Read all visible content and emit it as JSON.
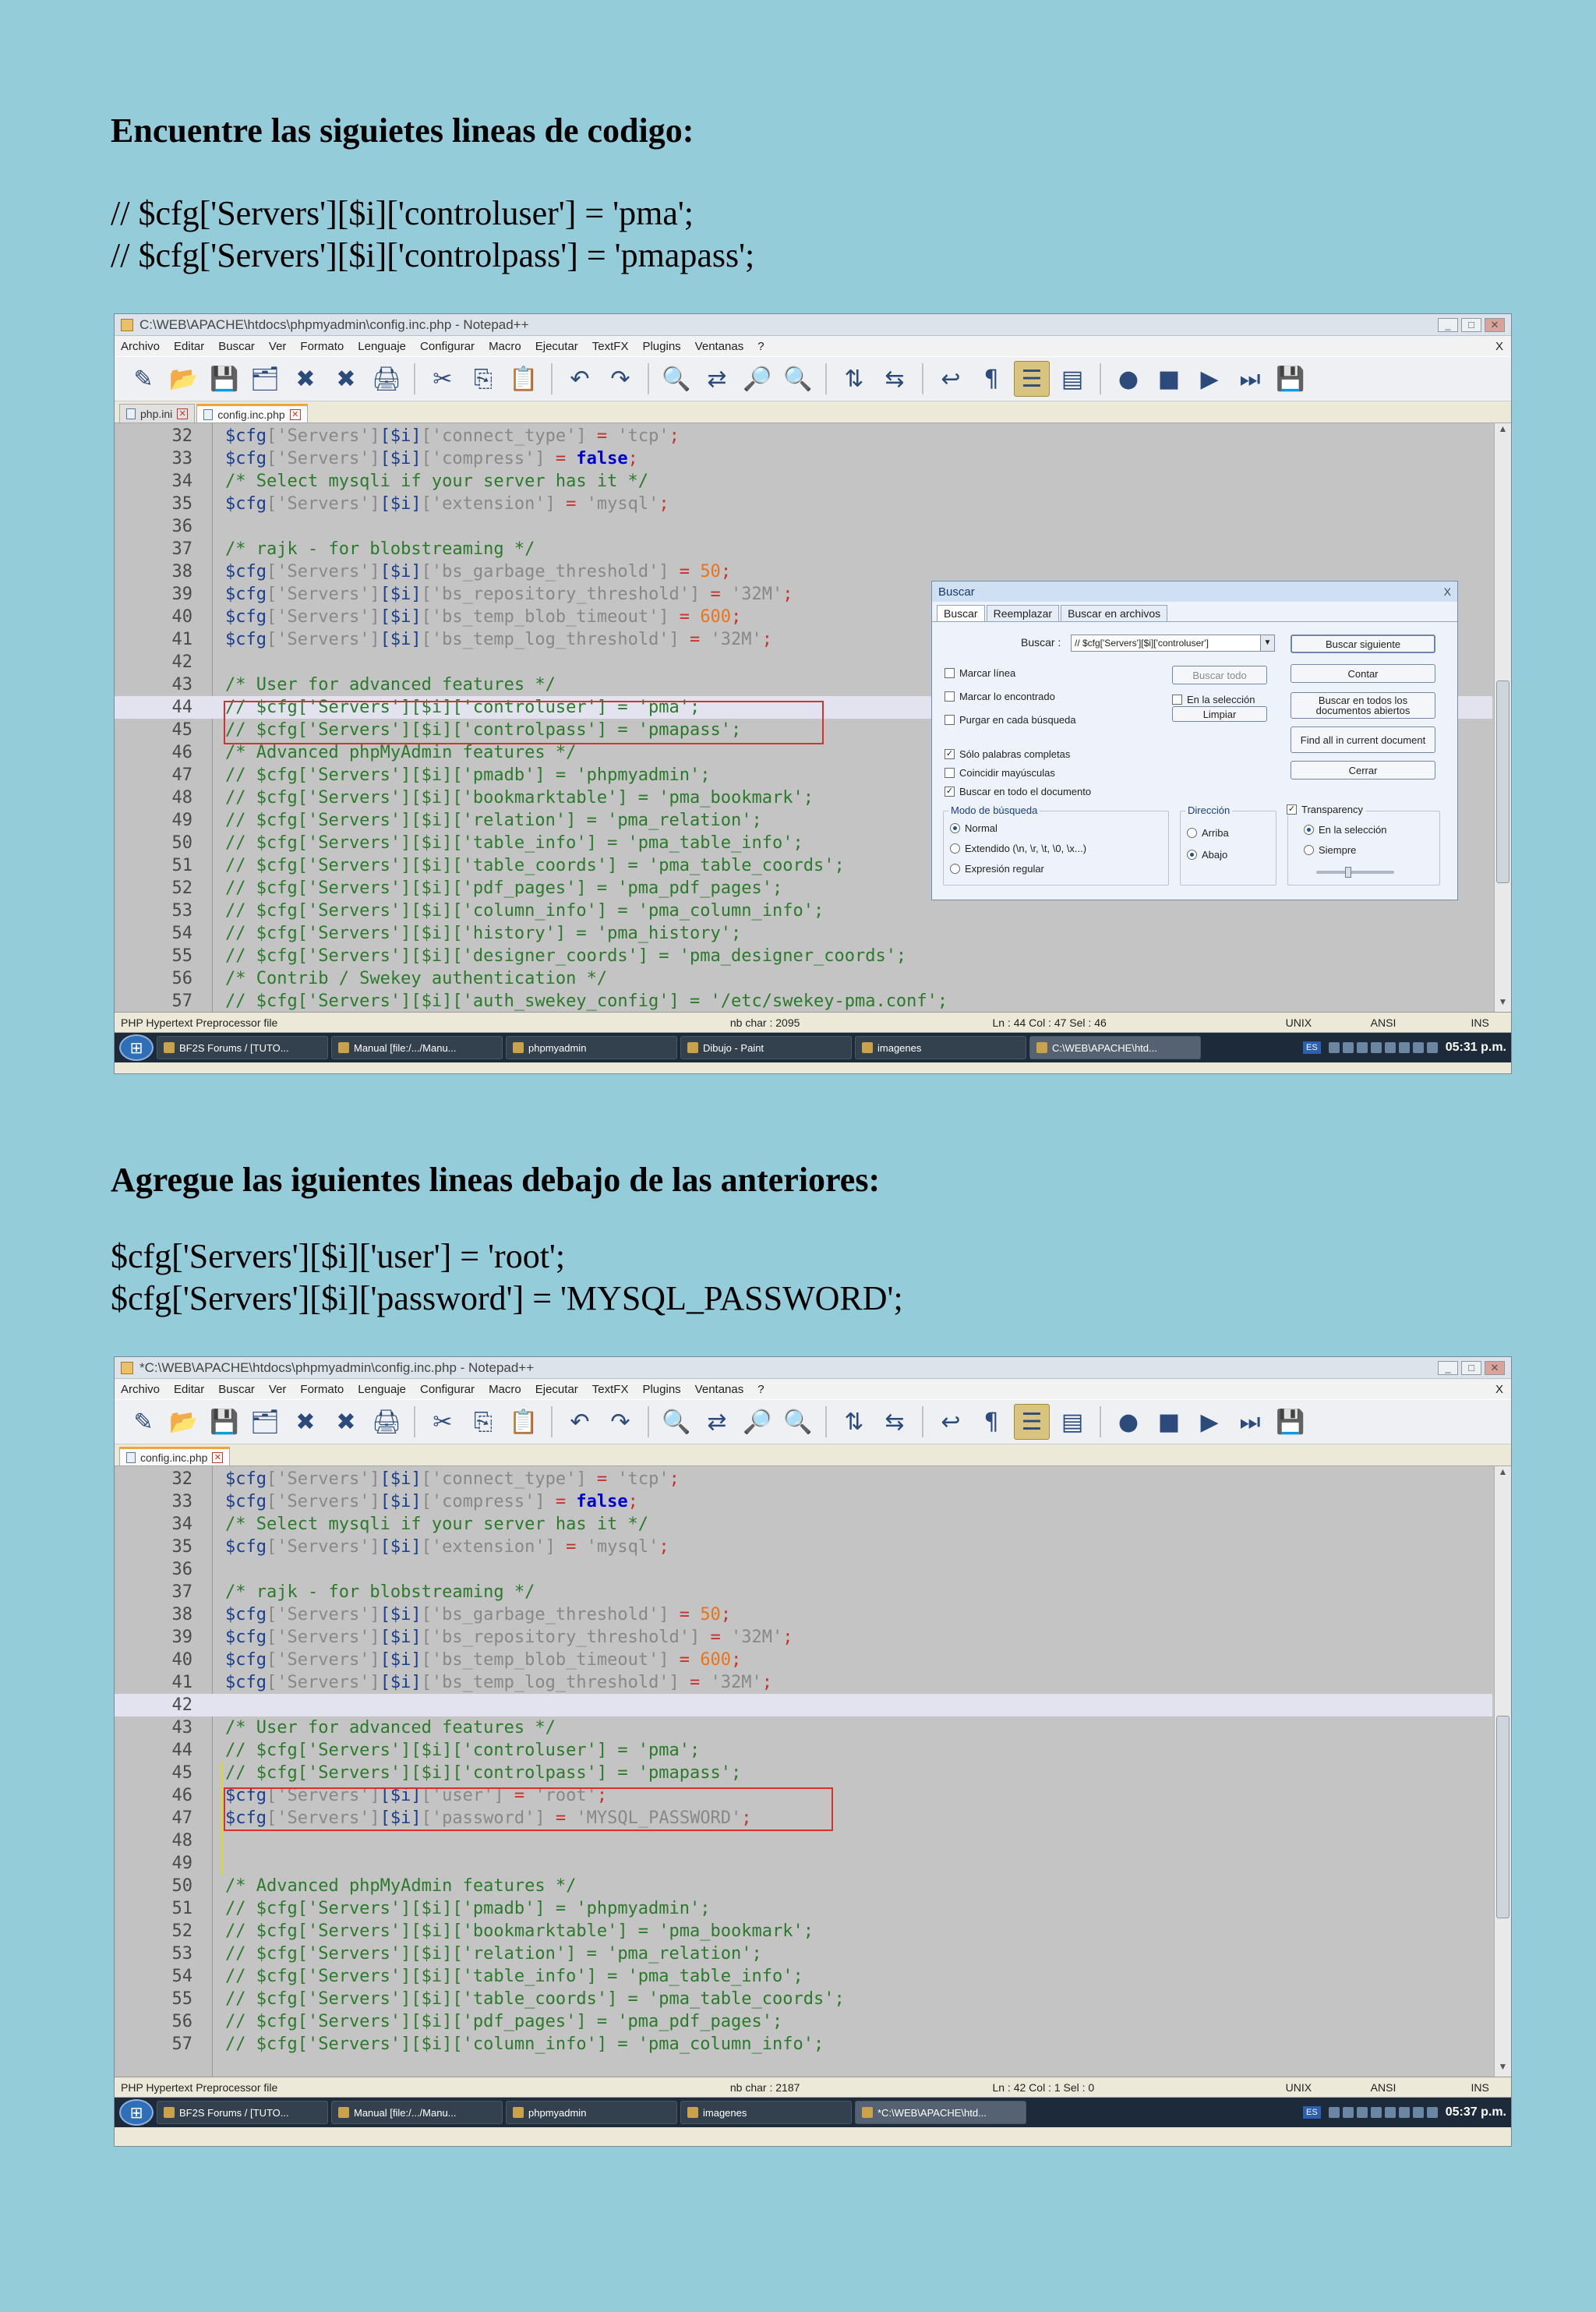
{
  "section1": {
    "heading": "Encuentre las siguietes lineas de codigo:",
    "lines": [
      "// $cfg['Servers'][$i]['controluser'] = 'pma';",
      "// $cfg['Servers'][$i]['controlpass'] = 'pmapass';"
    ]
  },
  "section2": {
    "heading": "Agregue las iguientes lineas debajo de las anteriores:",
    "lines": [
      "$cfg['Servers'][$i]['user'] = 'root';",
      "$cfg['Servers'][$i]['password'] = 'MYSQL_PASSWORD';"
    ]
  },
  "menu": [
    "Archivo",
    "Editar",
    "Buscar",
    "Ver",
    "Formato",
    "Lenguaje",
    "Configurar",
    "Macro",
    "Ejecutar",
    "TextFX",
    "Plugins",
    "Ventanas",
    "?"
  ],
  "menu_close": "X",
  "toolbar_icons": [
    {
      "name": "new-file-icon",
      "glyph": "✎"
    },
    {
      "name": "open-file-icon",
      "glyph": "📂"
    },
    {
      "name": "save-icon",
      "glyph": "💾"
    },
    {
      "name": "save-all-icon",
      "glyph": "🗂"
    },
    {
      "name": "close-icon",
      "glyph": "✖"
    },
    {
      "name": "close-all-icon",
      "glyph": "✖"
    },
    {
      "name": "print-icon",
      "glyph": "🖨"
    },
    {
      "name": "cut-icon",
      "glyph": "✂"
    },
    {
      "name": "copy-icon",
      "glyph": "⎘"
    },
    {
      "name": "paste-icon",
      "glyph": "📋"
    },
    {
      "name": "undo-icon",
      "glyph": "↶"
    },
    {
      "name": "redo-icon",
      "glyph": "↷"
    },
    {
      "name": "find-icon",
      "glyph": "🔍"
    },
    {
      "name": "replace-icon",
      "glyph": "⇄"
    },
    {
      "name": "zoom-in-icon",
      "glyph": "🔎"
    },
    {
      "name": "zoom-out-icon",
      "glyph": "🔍"
    },
    {
      "name": "sync-vertical-icon",
      "glyph": "⇅"
    },
    {
      "name": "sync-horizontal-icon",
      "glyph": "⇆"
    },
    {
      "name": "word-wrap-icon",
      "glyph": "↩"
    },
    {
      "name": "show-all-chars-icon",
      "glyph": "¶"
    },
    {
      "name": "indent-guide-icon",
      "glyph": "☰",
      "active": true
    },
    {
      "name": "user-lang-icon",
      "glyph": "▤"
    },
    {
      "name": "macro-record-icon",
      "glyph": "●"
    },
    {
      "name": "macro-stop-icon",
      "glyph": "■"
    },
    {
      "name": "macro-play-icon",
      "glyph": "▶"
    },
    {
      "name": "macro-play-multiple-icon",
      "glyph": "⏭"
    },
    {
      "name": "macro-save-icon",
      "glyph": "💾"
    }
  ],
  "colors": {
    "page_bg": "#94ccda",
    "editor_bg": "#c4c4c4",
    "var": "#1a3f8c",
    "string": "#888888",
    "operator": "#c9302c",
    "number": "#e8741e",
    "keyword": "#0000cc",
    "comment": "#2b7a2b",
    "red_box": "#d9302e"
  },
  "screenshot1": {
    "title": "C:\\WEB\\APACHE\\htdocs\\phpmyadmin\\config.inc.php - Notepad++",
    "tabs": [
      {
        "label": "php.ini",
        "active": false
      },
      {
        "label": "config.inc.php",
        "active": true
      }
    ],
    "code_lines": [
      {
        "n": "32",
        "segs": [
          [
            "var",
            "$cfg"
          ],
          [
            "str",
            "['Servers']"
          ],
          [
            "var",
            "[$i]"
          ],
          [
            "str",
            "['connect_type']"
          ],
          [
            "op",
            " = "
          ],
          [
            "str",
            "'tcp'"
          ],
          [
            "op",
            ";"
          ]
        ]
      },
      {
        "n": "33",
        "segs": [
          [
            "var",
            "$cfg"
          ],
          [
            "str",
            "['Servers']"
          ],
          [
            "var",
            "[$i]"
          ],
          [
            "str",
            "['compress']"
          ],
          [
            "op",
            " = "
          ],
          [
            "kw",
            "false"
          ],
          [
            "op",
            ";"
          ]
        ]
      },
      {
        "n": "34",
        "segs": [
          [
            "cm",
            "/* Select mysqli if your server has it */"
          ]
        ]
      },
      {
        "n": "35",
        "segs": [
          [
            "var",
            "$cfg"
          ],
          [
            "str",
            "['Servers']"
          ],
          [
            "var",
            "[$i]"
          ],
          [
            "str",
            "['extension']"
          ],
          [
            "op",
            " = "
          ],
          [
            "str",
            "'mysql'"
          ],
          [
            "op",
            ";"
          ]
        ]
      },
      {
        "n": "36",
        "segs": []
      },
      {
        "n": "37",
        "segs": [
          [
            "cm",
            "/* rajk - for blobstreaming */"
          ]
        ]
      },
      {
        "n": "38",
        "segs": [
          [
            "var",
            "$cfg"
          ],
          [
            "str",
            "['Servers']"
          ],
          [
            "var",
            "[$i]"
          ],
          [
            "str",
            "['bs_garbage_threshold']"
          ],
          [
            "op",
            " = "
          ],
          [
            "num",
            "50"
          ],
          [
            "op",
            ";"
          ]
        ]
      },
      {
        "n": "39",
        "segs": [
          [
            "var",
            "$cfg"
          ],
          [
            "str",
            "['Servers']"
          ],
          [
            "var",
            "[$i]"
          ],
          [
            "str",
            "['bs_repository_threshold']"
          ],
          [
            "op",
            " = "
          ],
          [
            "str",
            "'32M'"
          ],
          [
            "op",
            ";"
          ]
        ]
      },
      {
        "n": "40",
        "segs": [
          [
            "var",
            "$cfg"
          ],
          [
            "str",
            "['Servers']"
          ],
          [
            "var",
            "[$i]"
          ],
          [
            "str",
            "['bs_temp_blob_timeout']"
          ],
          [
            "op",
            " = "
          ],
          [
            "num",
            "600"
          ],
          [
            "op",
            ";"
          ]
        ]
      },
      {
        "n": "41",
        "segs": [
          [
            "var",
            "$cfg"
          ],
          [
            "str",
            "['Servers']"
          ],
          [
            "var",
            "[$i]"
          ],
          [
            "str",
            "['bs_temp_log_threshold']"
          ],
          [
            "op",
            " = "
          ],
          [
            "str",
            "'32M'"
          ],
          [
            "op",
            ";"
          ]
        ]
      },
      {
        "n": "42",
        "segs": []
      },
      {
        "n": "43",
        "segs": [
          [
            "cm",
            "/* User for advanced features */"
          ]
        ]
      },
      {
        "n": "44",
        "segs": [
          [
            "cm",
            "// $cfg['Servers'][$i]['controluser'] = 'pma';"
          ]
        ],
        "hl": true
      },
      {
        "n": "45",
        "segs": [
          [
            "cm",
            "// $cfg['Servers'][$i]['controlpass'] = 'pmapass';"
          ]
        ]
      },
      {
        "n": "46",
        "segs": [
          [
            "cm",
            "/* Advanced phpMyAdmin features */"
          ]
        ]
      },
      {
        "n": "47",
        "segs": [
          [
            "cm",
            "// $cfg['Servers'][$i]['pmadb'] = 'phpmyadmin';"
          ]
        ]
      },
      {
        "n": "48",
        "segs": [
          [
            "cm",
            "// $cfg['Servers'][$i]['bookmarktable'] = 'pma_bookmark';"
          ]
        ]
      },
      {
        "n": "49",
        "segs": [
          [
            "cm",
            "// $cfg['Servers'][$i]['relation'] = 'pma_relation';"
          ]
        ]
      },
      {
        "n": "50",
        "segs": [
          [
            "cm",
            "// $cfg['Servers'][$i]['table_info'] = 'pma_table_info';"
          ]
        ]
      },
      {
        "n": "51",
        "segs": [
          [
            "cm",
            "// $cfg['Servers'][$i]['table_coords'] = 'pma_table_coords';"
          ]
        ]
      },
      {
        "n": "52",
        "segs": [
          [
            "cm",
            "// $cfg['Servers'][$i]['pdf_pages'] = 'pma_pdf_pages';"
          ]
        ]
      },
      {
        "n": "53",
        "segs": [
          [
            "cm",
            "// $cfg['Servers'][$i]['column_info'] = 'pma_column_info';"
          ]
        ]
      },
      {
        "n": "54",
        "segs": [
          [
            "cm",
            "// $cfg['Servers'][$i]['history'] = 'pma_history';"
          ]
        ]
      },
      {
        "n": "55",
        "segs": [
          [
            "cm",
            "// $cfg['Servers'][$i]['designer_coords'] = 'pma_designer_coords';"
          ]
        ]
      },
      {
        "n": "56",
        "segs": [
          [
            "cm",
            "/* Contrib / Swekey authentication */"
          ]
        ]
      },
      {
        "n": "57",
        "segs": [
          [
            "cm",
            "// $cfg['Servers'][$i]['auth_swekey_config'] = '/etc/swekey-pma.conf';"
          ]
        ]
      }
    ],
    "status": {
      "filetype": "PHP Hypertext Preprocessor file",
      "nbchar": "nb char : 2095",
      "pos": "Ln : 44    Col : 47    Sel : 46",
      "eol": "UNIX",
      "enc": "ANSI",
      "mode": "INS"
    },
    "taskbar": [
      {
        "label": "BF2S Forums / [TUTO...",
        "active": false
      },
      {
        "label": "Manual [file:/.../Manu...",
        "active": false
      },
      {
        "label": "phpmyadmin",
        "active": false
      },
      {
        "label": "Dibujo - Paint",
        "active": false
      },
      {
        "label": "imagenes",
        "active": false
      },
      {
        "label": "C:\\WEB\\APACHE\\htd...",
        "active": true
      }
    ],
    "lang": "ES",
    "clock": "05:31 p.m."
  },
  "dialog": {
    "title": "Buscar",
    "close": "X",
    "tabs": [
      "Buscar",
      "Reemplazar",
      "Buscar en archivos"
    ],
    "find_label": "Buscar :",
    "find_value": "// $cfg['Servers'][$i]['controluser']",
    "buttons": {
      "find_next": "Buscar siguiente",
      "count": "Contar",
      "find_all_open": "Buscar en todos los documentos abiertos",
      "find_all_current": "Find all in current document",
      "close": "Cerrar",
      "find_all": "Buscar todo",
      "clear": "Limpiar"
    },
    "checks": {
      "mark_line": "Marcar línea",
      "mark_found": "Marcar lo encontrado",
      "purge": "Purgar en cada búsqueda",
      "in_selection": "En la selección",
      "whole_words": "Sólo palabras completas",
      "match_case": "Coincidir mayúsculas",
      "wrap": "Buscar en todo el documento"
    },
    "mode_label": "Modo de búsqueda",
    "modes": [
      "Normal",
      "Extendido (\\n, \\r, \\t, \\0, \\x...)",
      "Expresión regular"
    ],
    "direction_label": "Dirección",
    "directions": [
      "Arriba",
      "Abajo"
    ],
    "transparency_label": "Transparency",
    "transparency_opts": [
      "En la selección",
      "Siempre"
    ],
    "transparency_level": 0.4
  },
  "screenshot2": {
    "title": "*C:\\WEB\\APACHE\\htdocs\\phpmyadmin\\config.inc.php - Notepad++",
    "tabs": [
      {
        "label": "config.inc.php",
        "active": true
      }
    ],
    "code_lines": [
      {
        "n": "32",
        "segs": [
          [
            "var",
            "$cfg"
          ],
          [
            "str",
            "['Servers']"
          ],
          [
            "var",
            "[$i]"
          ],
          [
            "str",
            "['connect_type']"
          ],
          [
            "op",
            " = "
          ],
          [
            "str",
            "'tcp'"
          ],
          [
            "op",
            ";"
          ]
        ]
      },
      {
        "n": "33",
        "segs": [
          [
            "var",
            "$cfg"
          ],
          [
            "str",
            "['Servers']"
          ],
          [
            "var",
            "[$i]"
          ],
          [
            "str",
            "['compress']"
          ],
          [
            "op",
            " = "
          ],
          [
            "kw",
            "false"
          ],
          [
            "op",
            ";"
          ]
        ]
      },
      {
        "n": "34",
        "segs": [
          [
            "cm",
            "/* Select mysqli if your server has it */"
          ]
        ]
      },
      {
        "n": "35",
        "segs": [
          [
            "var",
            "$cfg"
          ],
          [
            "str",
            "['Servers']"
          ],
          [
            "var",
            "[$i]"
          ],
          [
            "str",
            "['extension']"
          ],
          [
            "op",
            " = "
          ],
          [
            "str",
            "'mysql'"
          ],
          [
            "op",
            ";"
          ]
        ]
      },
      {
        "n": "36",
        "segs": []
      },
      {
        "n": "37",
        "segs": [
          [
            "cm",
            "/* rajk - for blobstreaming */"
          ]
        ]
      },
      {
        "n": "38",
        "segs": [
          [
            "var",
            "$cfg"
          ],
          [
            "str",
            "['Servers']"
          ],
          [
            "var",
            "[$i]"
          ],
          [
            "str",
            "['bs_garbage_threshold']"
          ],
          [
            "op",
            " = "
          ],
          [
            "num",
            "50"
          ],
          [
            "op",
            ";"
          ]
        ]
      },
      {
        "n": "39",
        "segs": [
          [
            "var",
            "$cfg"
          ],
          [
            "str",
            "['Servers']"
          ],
          [
            "var",
            "[$i]"
          ],
          [
            "str",
            "['bs_repository_threshold']"
          ],
          [
            "op",
            " = "
          ],
          [
            "str",
            "'32M'"
          ],
          [
            "op",
            ";"
          ]
        ]
      },
      {
        "n": "40",
        "segs": [
          [
            "var",
            "$cfg"
          ],
          [
            "str",
            "['Servers']"
          ],
          [
            "var",
            "[$i]"
          ],
          [
            "str",
            "['bs_temp_blob_timeout']"
          ],
          [
            "op",
            " = "
          ],
          [
            "num",
            "600"
          ],
          [
            "op",
            ";"
          ]
        ]
      },
      {
        "n": "41",
        "segs": [
          [
            "var",
            "$cfg"
          ],
          [
            "str",
            "['Servers']"
          ],
          [
            "var",
            "[$i]"
          ],
          [
            "str",
            "['bs_temp_log_threshold']"
          ],
          [
            "op",
            " = "
          ],
          [
            "str",
            "'32M'"
          ],
          [
            "op",
            ";"
          ]
        ]
      },
      {
        "n": "42",
        "segs": [],
        "hl": true
      },
      {
        "n": "43",
        "segs": [
          [
            "cm",
            "/* User for advanced features */"
          ]
        ]
      },
      {
        "n": "44",
        "segs": [
          [
            "cm",
            "// $cfg['Servers'][$i]['controluser'] = 'pma';"
          ]
        ]
      },
      {
        "n": "45",
        "segs": [
          [
            "cm",
            "// $cfg['Servers'][$i]['controlpass'] = 'pmapass';"
          ]
        ],
        "change": true
      },
      {
        "n": "46",
        "segs": [
          [
            "var",
            "$cfg"
          ],
          [
            "str",
            "['Servers']"
          ],
          [
            "var",
            "[$i]"
          ],
          [
            "str",
            "['user']"
          ],
          [
            "op",
            " = "
          ],
          [
            "str",
            "'root'"
          ],
          [
            "op",
            ";"
          ]
        ],
        "change": true
      },
      {
        "n": "47",
        "segs": [
          [
            "var",
            "$cfg"
          ],
          [
            "str",
            "['Servers']"
          ],
          [
            "var",
            "[$i]"
          ],
          [
            "str",
            "['password']"
          ],
          [
            "op",
            " = "
          ],
          [
            "str",
            "'MYSQL_PASSWORD'"
          ],
          [
            "op",
            ";"
          ]
        ],
        "change": true
      },
      {
        "n": "48",
        "segs": [],
        "change": true
      },
      {
        "n": "49",
        "segs": [],
        "change": true
      },
      {
        "n": "50",
        "segs": [
          [
            "cm",
            "/* Advanced phpMyAdmin features */"
          ]
        ]
      },
      {
        "n": "51",
        "segs": [
          [
            "cm",
            "// $cfg['Servers'][$i]['pmadb'] = 'phpmyadmin';"
          ]
        ]
      },
      {
        "n": "52",
        "segs": [
          [
            "cm",
            "// $cfg['Servers'][$i]['bookmarktable'] = 'pma_bookmark';"
          ]
        ]
      },
      {
        "n": "53",
        "segs": [
          [
            "cm",
            "// $cfg['Servers'][$i]['relation'] = 'pma_relation';"
          ]
        ]
      },
      {
        "n": "54",
        "segs": [
          [
            "cm",
            "// $cfg['Servers'][$i]['table_info'] = 'pma_table_info';"
          ]
        ]
      },
      {
        "n": "55",
        "segs": [
          [
            "cm",
            "// $cfg['Servers'][$i]['table_coords'] = 'pma_table_coords';"
          ]
        ]
      },
      {
        "n": "56",
        "segs": [
          [
            "cm",
            "// $cfg['Servers'][$i]['pdf_pages'] = 'pma_pdf_pages';"
          ]
        ]
      },
      {
        "n": "57",
        "segs": [
          [
            "cm",
            "// $cfg['Servers'][$i]['column_info'] = 'pma_column_info';"
          ]
        ]
      }
    ],
    "status": {
      "filetype": "PHP Hypertext Preprocessor file",
      "nbchar": "nb char : 2187",
      "pos": "Ln : 42    Col : 1    Sel : 0",
      "eol": "UNIX",
      "enc": "ANSI",
      "mode": "INS"
    },
    "taskbar": [
      {
        "label": "BF2S Forums / [TUTO...",
        "active": false
      },
      {
        "label": "Manual [file:/.../Manu...",
        "active": false
      },
      {
        "label": "phpmyadmin",
        "active": false
      },
      {
        "label": "imagenes",
        "active": false
      },
      {
        "label": "*C:\\WEB\\APACHE\\htd...",
        "active": true
      }
    ],
    "lang": "ES",
    "clock": "05:37 p.m."
  }
}
